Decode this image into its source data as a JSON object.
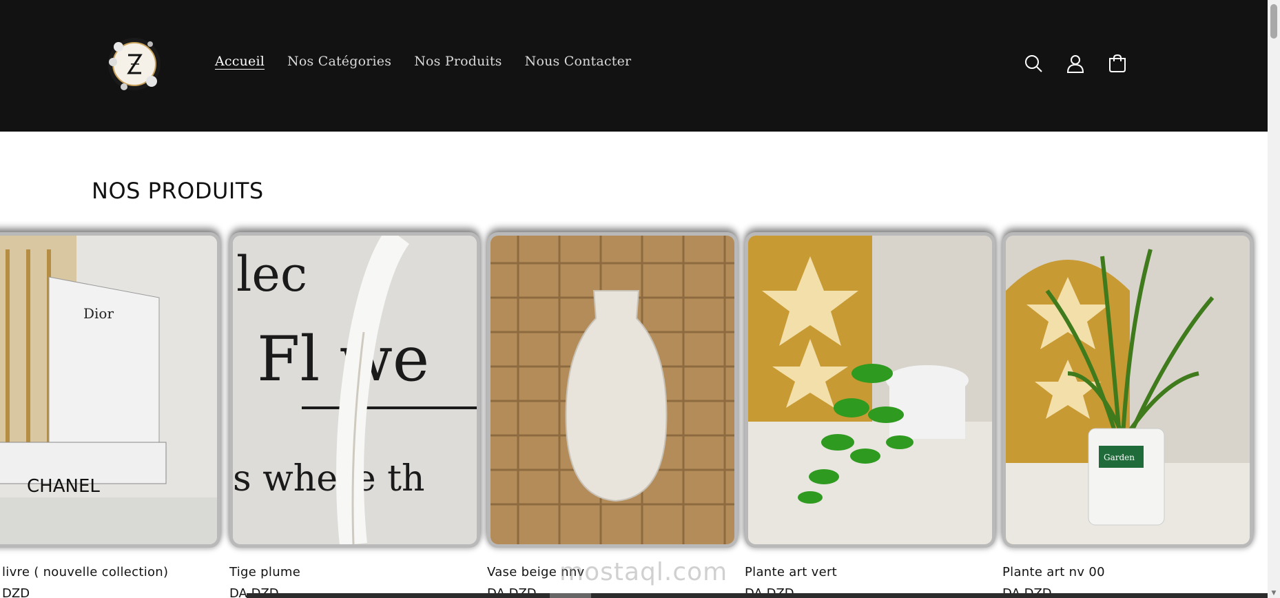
{
  "header": {
    "nav": [
      {
        "label": "Accueil",
        "active": true
      },
      {
        "label": "Nos Catégories",
        "active": false
      },
      {
        "label": "Nos Produits",
        "active": false
      },
      {
        "label": "Nous Contacter",
        "active": false
      }
    ],
    "icons": [
      "search-icon",
      "account-icon",
      "cart-icon"
    ],
    "colors": {
      "background": "#121212",
      "nav_text": "#d9d9d9"
    }
  },
  "section": {
    "title": "NOS PRODUITS"
  },
  "products": [
    {
      "title": "livre ( nouvelle collection)",
      "price": "DZD"
    },
    {
      "title": "Tige plume",
      "price": "DA DZD"
    },
    {
      "title": "Vase beige nnv",
      "price": "DA DZD"
    },
    {
      "title": "Plante art vert",
      "price": "DA DZD"
    },
    {
      "title": "Plante art nv 00",
      "price": "DA DZD"
    }
  ],
  "watermark": "mostaql.com"
}
